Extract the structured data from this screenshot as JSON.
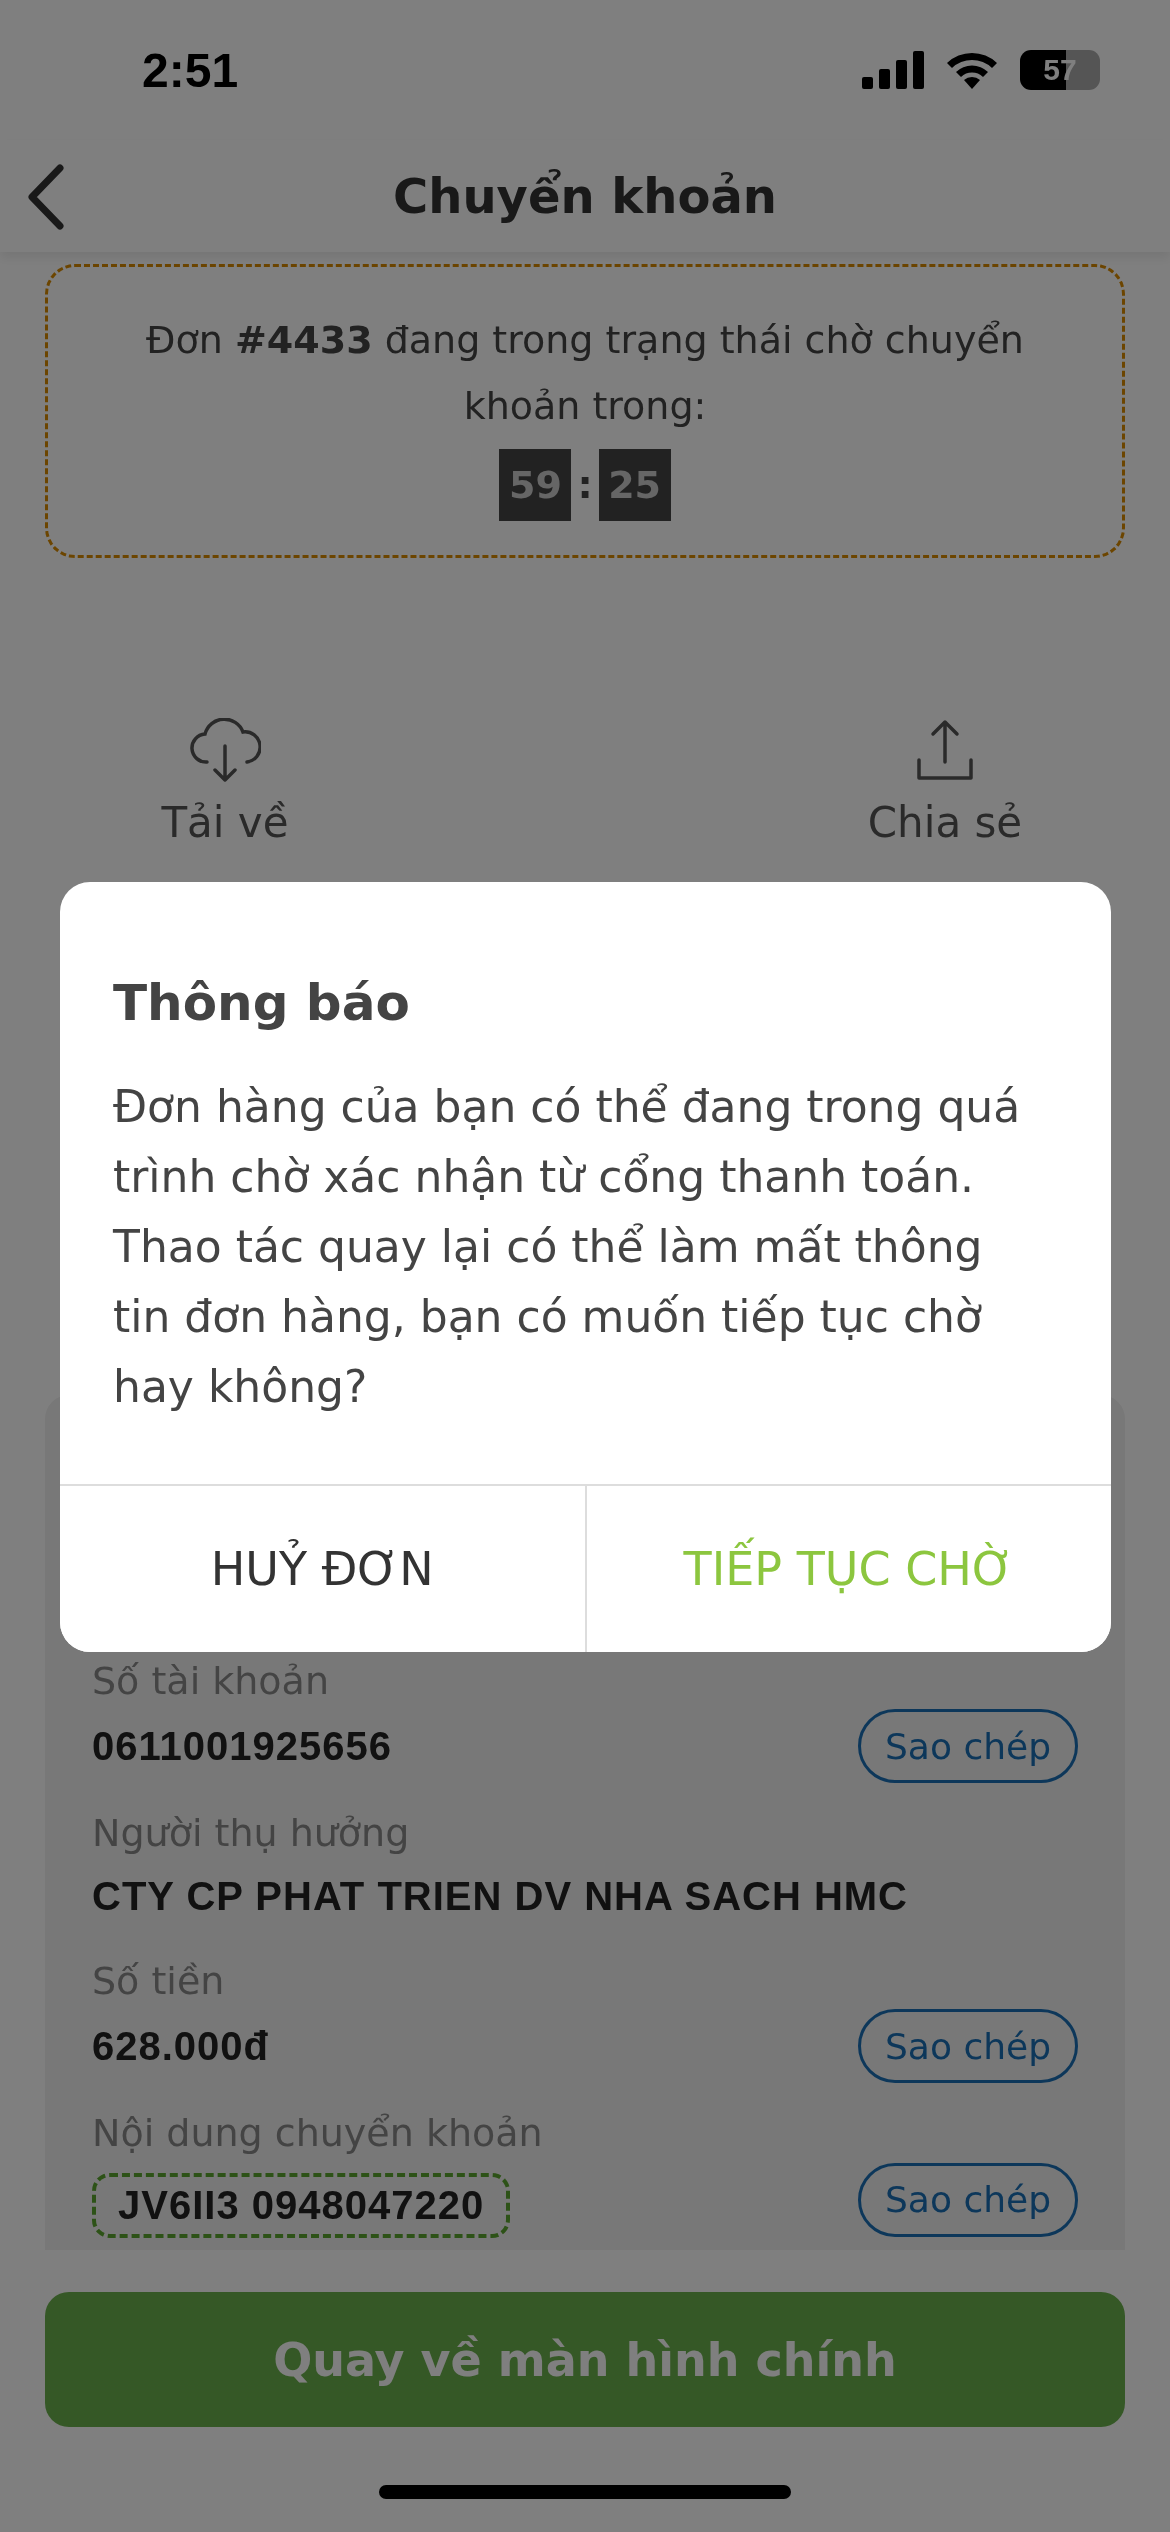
{
  "status_bar": {
    "time": "2:51",
    "battery": "57"
  },
  "header": {
    "title": "Chuyển khoản"
  },
  "order_notice": {
    "text": "Đơn **#4433** đang trong trạng thái chờ chuyển khoản trong:",
    "timer": [
      "59",
      "25"
    ],
    "separator": ":"
  },
  "actions": [
    {
      "kind": "download",
      "label": "Tải về"
    },
    {
      "kind": "share",
      "label": "Chia sẻ"
    }
  ],
  "transfer_details": [
    {
      "label": "Số tài khoản",
      "value": "0611001925656",
      "copy": "Sao chép",
      "highlighted": false
    },
    {
      "label": "Người thụ hưởng",
      "value": "CTY CP PHAT TRIEN DV NHA SACH HMC",
      "highlighted": false
    },
    {
      "label": "Số tiền",
      "value": "628.000đ",
      "copy": "Sao chép",
      "highlighted": false
    },
    {
      "label": "Nội dung chuyển khoản",
      "value": "JV6II3 0948047220",
      "copy": "Sao chép",
      "highlighted": true
    }
  ],
  "primary_button": "Quay về màn hình chính",
  "dialog": {
    "title": "Thông báo",
    "message": "Đơn hàng của bạn có thể đang trong quá trình chờ xác nhận từ cổng thanh toán. Thao tác quay lại có thể làm mất thông tin đơn hàng, bạn có muốn tiếp tục chờ hay không?",
    "buttons": [
      {
        "kind": "cancel",
        "label": "HUỶ ĐƠN"
      },
      {
        "kind": "confirm",
        "label": "TIẾP TỤC CHỜ"
      }
    ]
  }
}
